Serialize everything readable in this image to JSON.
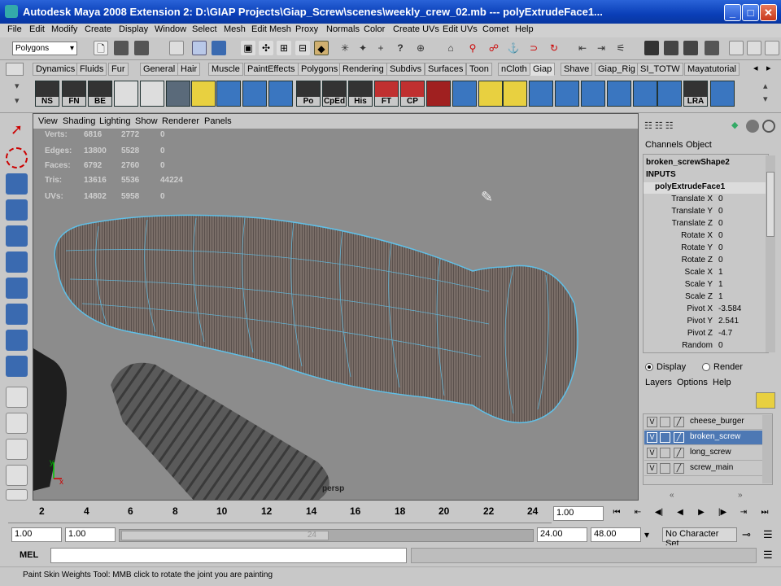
{
  "window": {
    "title": "Autodesk Maya 2008 Extension 2: D:\\GIAP Projects\\Giap_Screw\\scenes\\weekly_crew_02.mb   ---   polyExtrudeFace1..."
  },
  "menu": [
    "File",
    "Edit",
    "Modify",
    "Create",
    "Display",
    "Window",
    "Select",
    "Mesh",
    "Edit Mesh",
    "Proxy",
    "Normals",
    "Color",
    "Create UVs",
    "Edit UVs",
    "Comet",
    "Help"
  ],
  "statusline": {
    "mode": "Polygons"
  },
  "shelf_tabs": [
    "Dynamics",
    "Fluids",
    "Fur",
    "General",
    "Hair",
    "Muscle",
    "PaintEffects",
    "Polygons",
    "Rendering",
    "Subdivs",
    "Surfaces",
    "Toon",
    "nCloth",
    "Giap",
    "Shave",
    "Giap_Rig",
    "SI_TOTW",
    "Mayatutorial"
  ],
  "active_shelf_tab": "Giap",
  "shelf_labels": [
    "NS",
    "FN",
    "BE",
    "Po",
    "CpEd",
    "His",
    "FT",
    "CP",
    "LRA"
  ],
  "viewport": {
    "menu": [
      "View",
      "Shading",
      "Lighting",
      "Show",
      "Renderer",
      "Panels"
    ],
    "hud": [
      {
        "label": "Verts:",
        "a": "6816",
        "b": "2772",
        "c": "0"
      },
      {
        "label": "Edges:",
        "a": "13800",
        "b": "5528",
        "c": "0"
      },
      {
        "label": "Faces:",
        "a": "6792",
        "b": "2760",
        "c": "0"
      },
      {
        "label": "Tris:",
        "a": "13616",
        "b": "5536",
        "c": "44224"
      },
      {
        "label": "UVs:",
        "a": "14802",
        "b": "5958",
        "c": "0"
      }
    ],
    "camera": "persp",
    "axis_x": "x",
    "axis_y": "y"
  },
  "channelbox": {
    "tabs": [
      "Channels",
      "Object"
    ],
    "node": "broken_screwShape2",
    "inputs": "INPUTS",
    "input_node": "polyExtrudeFace1",
    "attrs": [
      {
        "k": "Translate X",
        "v": "0"
      },
      {
        "k": "Translate Y",
        "v": "0"
      },
      {
        "k": "Translate Z",
        "v": "0"
      },
      {
        "k": "Rotate X",
        "v": "0"
      },
      {
        "k": "Rotate Y",
        "v": "0"
      },
      {
        "k": "Rotate Z",
        "v": "0"
      },
      {
        "k": "Scale X",
        "v": "1"
      },
      {
        "k": "Scale Y",
        "v": "1"
      },
      {
        "k": "Scale Z",
        "v": "1"
      },
      {
        "k": "Pivot X",
        "v": "-3.584"
      },
      {
        "k": "Pivot Y",
        "v": "2.541"
      },
      {
        "k": "Pivot Z",
        "v": "-4.7"
      },
      {
        "k": "Random",
        "v": "0"
      }
    ]
  },
  "layers": {
    "display_label": "Display",
    "render_label": "Render",
    "menu": [
      "Layers",
      "Options",
      "Help"
    ],
    "items": [
      {
        "v": "V",
        "name": "cheese_burger",
        "sel": false
      },
      {
        "v": "V",
        "name": "broken_screw",
        "sel": true
      },
      {
        "v": "V",
        "name": "long_screw",
        "sel": false
      },
      {
        "v": "V",
        "name": "screw_main",
        "sel": false
      }
    ]
  },
  "timeline": {
    "ticks": [
      "2",
      "4",
      "6",
      "8",
      "10",
      "12",
      "14",
      "16",
      "18",
      "20",
      "22",
      "24"
    ],
    "current_frame": "1.00",
    "range_start": "1.00",
    "range_start2": "1.00",
    "slider_end": "24",
    "range_end": "24.00",
    "range_end2": "48.00",
    "character": "No Character Set"
  },
  "cmdline": {
    "label": "MEL"
  },
  "help": {
    "text": "Paint Skin Weights Tool: MMB click to rotate the joint you are painting"
  }
}
